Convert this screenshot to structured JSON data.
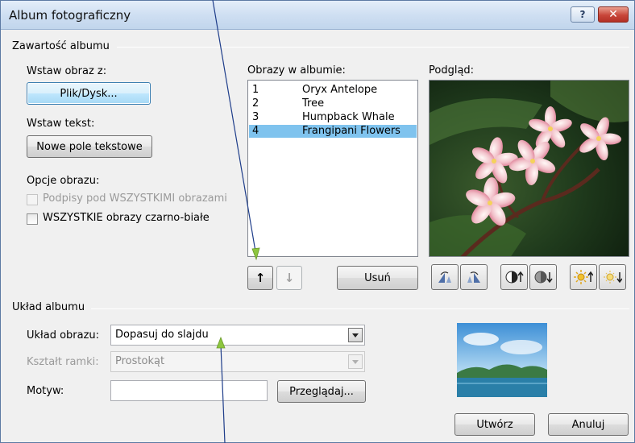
{
  "window": {
    "title": "Album fotograficzny",
    "help_symbol": "?",
    "close_symbol": "✕"
  },
  "album_content": {
    "section_title": "Zawartość albumu",
    "insert_picture_label": "Wstaw obraz z:",
    "file_disk_button": "Plik/Dysk...",
    "insert_text_label": "Wstaw tekst:",
    "new_textbox_button": "Nowe pole tekstowe",
    "picture_options_label": "Opcje obrazu:",
    "captions_checkbox": "Podpisy pod WSZYSTKIMI obrazami",
    "bw_checkbox": "WSZYSTKIE obrazy czarno-białe"
  },
  "pictures": {
    "label": "Obrazy w albumie:",
    "items": [
      {
        "num": "1",
        "name": "Oryx Antelope",
        "selected": false
      },
      {
        "num": "2",
        "name": "Tree",
        "selected": false
      },
      {
        "num": "3",
        "name": "Humpback Whale",
        "selected": false
      },
      {
        "num": "4",
        "name": "Frangipani Flowers",
        "selected": true
      }
    ],
    "move_up_symbol": "↑",
    "move_down_symbol": "↓",
    "remove_button": "Usuń"
  },
  "preview": {
    "label": "Podgląd:",
    "tool_icons": [
      "rotate-left-icon",
      "rotate-right-icon",
      "contrast-up-icon",
      "contrast-down-icon",
      "brightness-up-icon",
      "brightness-down-icon"
    ]
  },
  "album_layout": {
    "section_title": "Układ albumu",
    "picture_layout_label": "Układ obrazu:",
    "picture_layout_value": "Dopasuj do slajdu",
    "frame_shape_label": "Kształt ramki:",
    "frame_shape_value": "Prostokąt",
    "theme_label": "Motyw:",
    "theme_value": "",
    "browse_button": "Przeglądaj..."
  },
  "footer": {
    "create_button": "Utwórz",
    "cancel_button": "Anuluj"
  },
  "colors": {
    "selection": "#7fc3ee",
    "annotation_arrow": "#8dc63f"
  }
}
